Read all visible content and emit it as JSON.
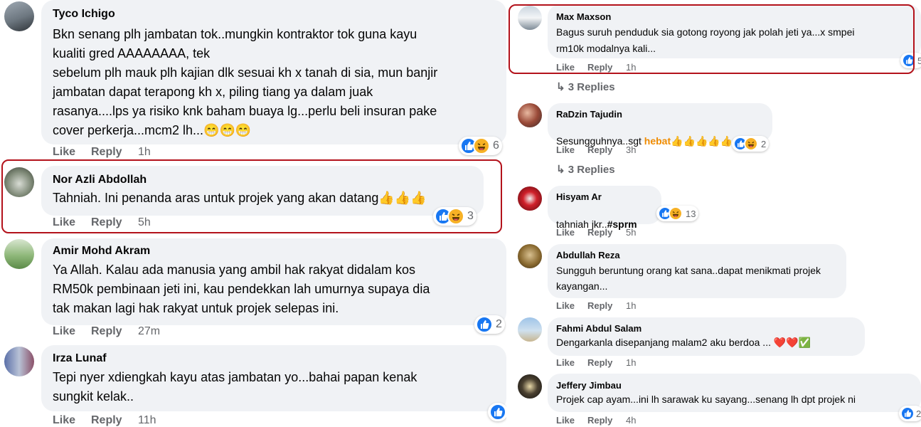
{
  "left": [
    {
      "name": "Tyco Ichigo",
      "lines": [
        "Bkn senang plh jambatan tok..mungkin kontraktor tok guna kayu",
        "kualiti gred AAAAAAAA, tek",
        "sebelum plh mauk plh kajian dlk sesuai kh x tanah di sia, mun banjir",
        "jambatan dapat terapong kh x, piling tiang ya dalam juak",
        "rasanya....lps ya risiko knk baham buaya lg...perlu beli insuran pake",
        "cover perkerja...mcm2 lh...😁😁😁"
      ],
      "like": "Like",
      "reply": "Reply",
      "time": "1h",
      "count": "6"
    },
    {
      "name": "Nor Azli Abdollah",
      "lines": [
        "Tahniah. Ini penanda aras untuk projek yang akan datang👍👍👍"
      ],
      "like": "Like",
      "reply": "Reply",
      "time": "5h",
      "count": "3"
    },
    {
      "name": "Amir Mohd Akram",
      "lines": [
        "Ya Allah. Kalau ada manusia yang ambil hak rakyat didalam kos",
        "RM50k pembinaan jeti ini, kau pendekkan lah umurnya supaya dia",
        "tak makan lagi hak rakyat untuk projek selepas ini."
      ],
      "like": "Like",
      "reply": "Reply",
      "time": "27m",
      "count": "2"
    },
    {
      "name": "Irza Lunaf",
      "lines": [
        "Tepi nyer xdiengkah kayu atas jambatan yo...bahai papan kenak",
        "sungkit kelak.."
      ],
      "like": "Like",
      "reply": "Reply",
      "time": "11h",
      "count": ""
    }
  ],
  "right": [
    {
      "name": "Max Maxson",
      "lines": [
        "Bagus suruh penduduk sia gotong royong jak polah jeti ya...x smpei",
        "rm10k modalnya kali..."
      ],
      "like": "Like",
      "reply": "Reply",
      "time": "1h",
      "count": "5",
      "replies": "3 Replies"
    },
    {
      "name": "RaDzin Tajudin",
      "prefix": "Sesungguhnya..sgt ",
      "hebat": "hebat",
      "suffix": "👍👍👍👍👍",
      "like": "Like",
      "reply": "Reply",
      "time": "3h",
      "count": "2",
      "replies": "3 Replies"
    },
    {
      "name": "Hisyam Ar",
      "prefix": "tahniah jkr..",
      "tag": "#sprm",
      "like": "Like",
      "reply": "Reply",
      "time": "5h",
      "count": "13"
    },
    {
      "name": "Abdullah Reza",
      "lines": [
        "Sungguh beruntung orang kat sana..dapat menikmati projek",
        "kayangan..."
      ],
      "like": "Like",
      "reply": "Reply",
      "time": "1h"
    },
    {
      "name": "Fahmi Abdul Salam",
      "lines": [
        "Dengarkanla disepanjang malam2 aku berdoa ... ❤️❤️✅"
      ],
      "like": "Like",
      "reply": "Reply",
      "time": "1h"
    },
    {
      "name": "Jeffery Jimbau",
      "lines": [
        "Projek cap ayam...ini lh sarawak ku sayang...senang lh dpt projek ni"
      ],
      "like": "Like",
      "reply": "Reply",
      "time": "4h",
      "count": "2"
    }
  ],
  "colors": {
    "accent": "#1877f2",
    "highlight": "#b3121b",
    "bubble": "#f0f2f5",
    "meta": "#65676b"
  },
  "icons": [
    "like-icon",
    "haha-icon",
    "reply-arrow-icon",
    "avatar"
  ]
}
